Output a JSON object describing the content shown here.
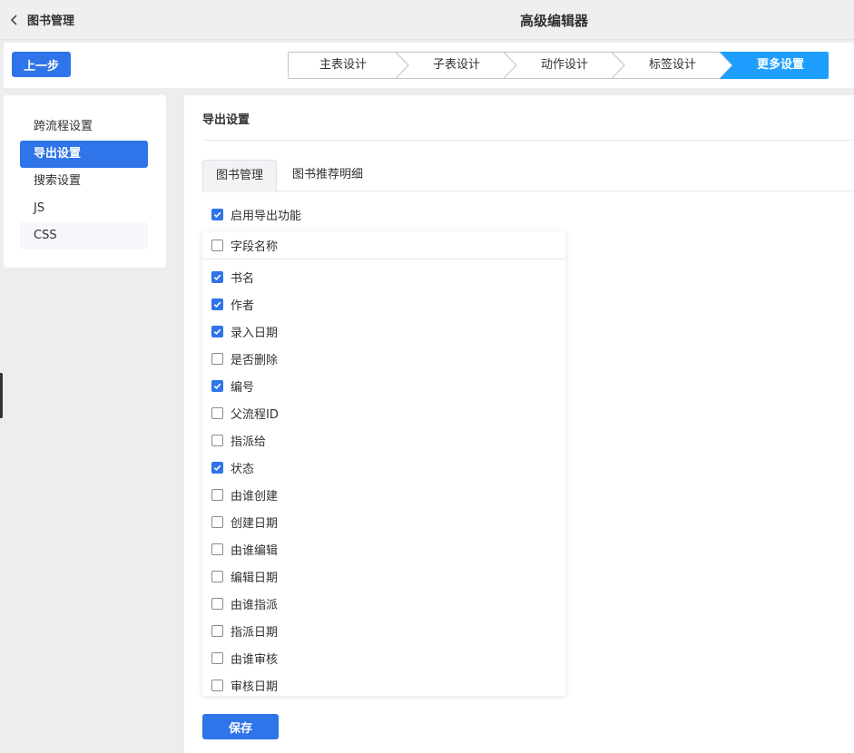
{
  "header": {
    "back_label": "图书管理",
    "title": "高级编辑器"
  },
  "toolbar": {
    "prev_label": "上一步"
  },
  "steps": [
    {
      "label": "主表设计",
      "active": false
    },
    {
      "label": "子表设计",
      "active": false
    },
    {
      "label": "动作设计",
      "active": false
    },
    {
      "label": "标签设计",
      "active": false
    },
    {
      "label": "更多设置",
      "active": true
    }
  ],
  "colors": {
    "accent": "#2f74e8",
    "step_active": "#1e9fff",
    "background": "#ededed"
  },
  "sidebar": {
    "items": [
      {
        "label": "跨流程设置",
        "active": false
      },
      {
        "label": "导出设置",
        "active": true
      },
      {
        "label": "搜索设置",
        "active": false
      },
      {
        "label": "JS",
        "active": false
      },
      {
        "label": "CSS",
        "active": false
      }
    ]
  },
  "main": {
    "section_title": "导出设置",
    "tabs": [
      {
        "label": "图书管理",
        "active": true
      },
      {
        "label": "图书推荐明细",
        "active": false
      }
    ],
    "enable_export": {
      "label": "启用导出功能",
      "checked": true
    },
    "field_header": {
      "label": "字段名称",
      "checked": false
    },
    "fields": [
      {
        "label": "书名",
        "checked": true
      },
      {
        "label": "作者",
        "checked": true
      },
      {
        "label": "录入日期",
        "checked": true
      },
      {
        "label": "是否删除",
        "checked": false
      },
      {
        "label": "编号",
        "checked": true
      },
      {
        "label": "父流程ID",
        "checked": false
      },
      {
        "label": "指派给",
        "checked": false
      },
      {
        "label": "状态",
        "checked": true
      },
      {
        "label": "由谁创建",
        "checked": false
      },
      {
        "label": "创建日期",
        "checked": false
      },
      {
        "label": "由谁编辑",
        "checked": false
      },
      {
        "label": "编辑日期",
        "checked": false
      },
      {
        "label": "由谁指派",
        "checked": false
      },
      {
        "label": "指派日期",
        "checked": false
      },
      {
        "label": "由谁审核",
        "checked": false
      },
      {
        "label": "审核日期",
        "checked": false
      }
    ],
    "save_label": "保存"
  }
}
